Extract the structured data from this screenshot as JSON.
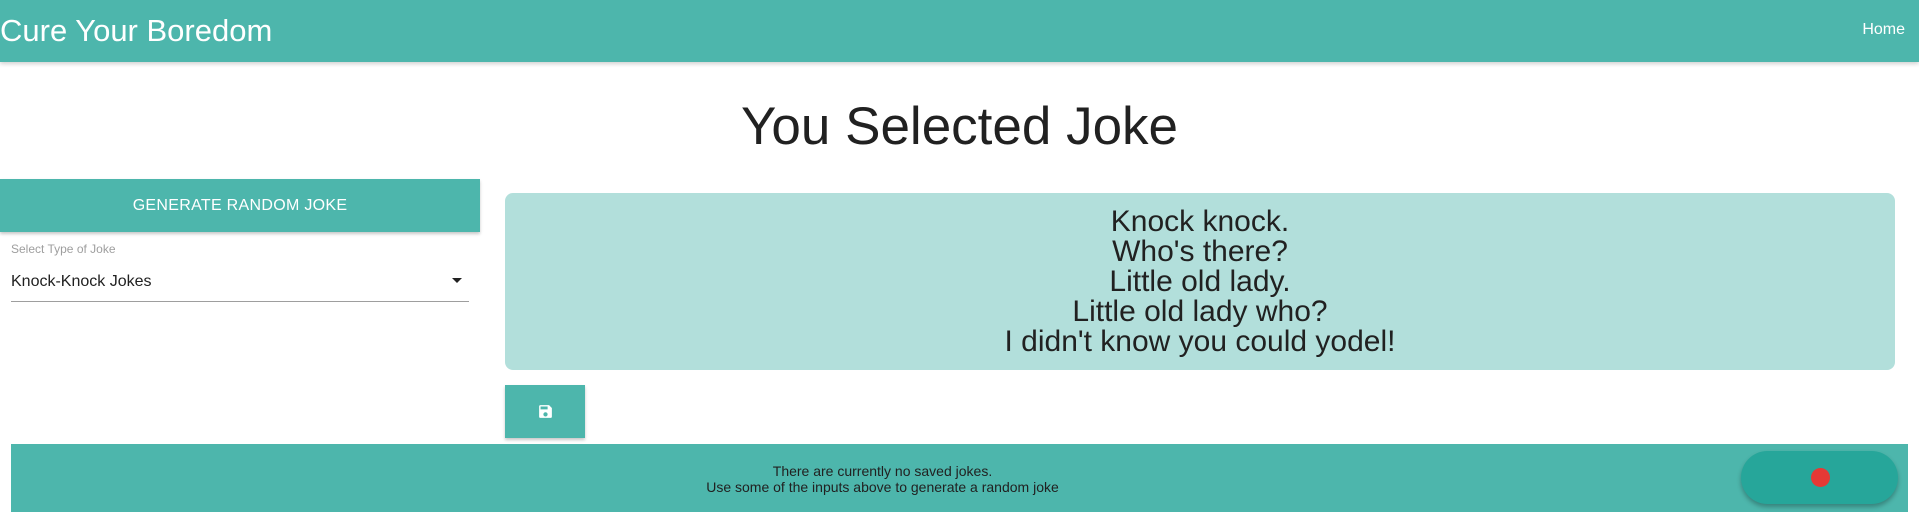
{
  "navbar": {
    "brand": "Cure Your Boredom",
    "links": [
      {
        "label": "Home"
      }
    ],
    "color": "#4db6ac"
  },
  "main": {
    "title": "You Selected Joke"
  },
  "controls": {
    "generate_label": "Generate Random Joke",
    "select": {
      "label": "Select Type of Joke",
      "value": "Knock-Knock Jokes",
      "icon": "caret-down-icon"
    }
  },
  "joke": {
    "lines": [
      "Knock knock.",
      "Who's there?",
      "Little old lady.",
      "Little old lady who?",
      "I didn't know you could yodel!"
    ],
    "card_color": "#b2dfdb"
  },
  "save_button": {
    "icon": "save-icon"
  },
  "footer": {
    "lines": [
      "There are currently no saved jokes.",
      "Use some of the inputs above to generate a random joke"
    ]
  },
  "fab": {
    "icon": "red-dot-icon",
    "dot_color": "#e53935",
    "color": "#26a69a"
  }
}
